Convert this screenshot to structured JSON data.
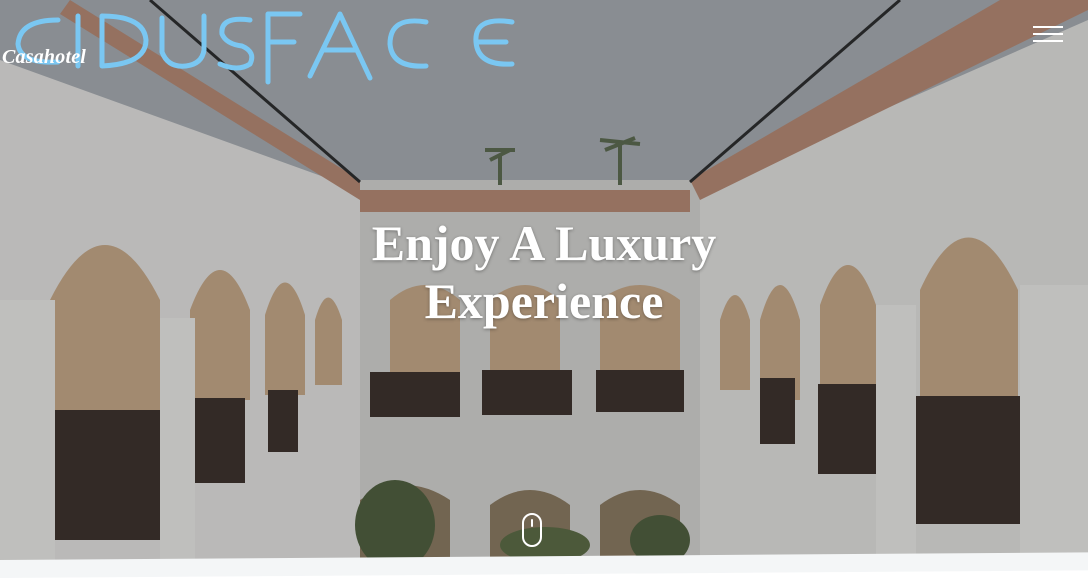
{
  "header": {
    "logo_scribble_text": "CIDUSFACE",
    "brand_text": "Casahotel",
    "menu_icon": "hamburger-menu-icon"
  },
  "hero": {
    "headline_line1": "Enjoy A Luxury",
    "headline_line2": "Experience",
    "scroll_icon": "mouse-scroll-icon"
  },
  "colors": {
    "scribble": "#7ac7f2",
    "text": "#ffffff",
    "terracotta": "#b98a73"
  }
}
